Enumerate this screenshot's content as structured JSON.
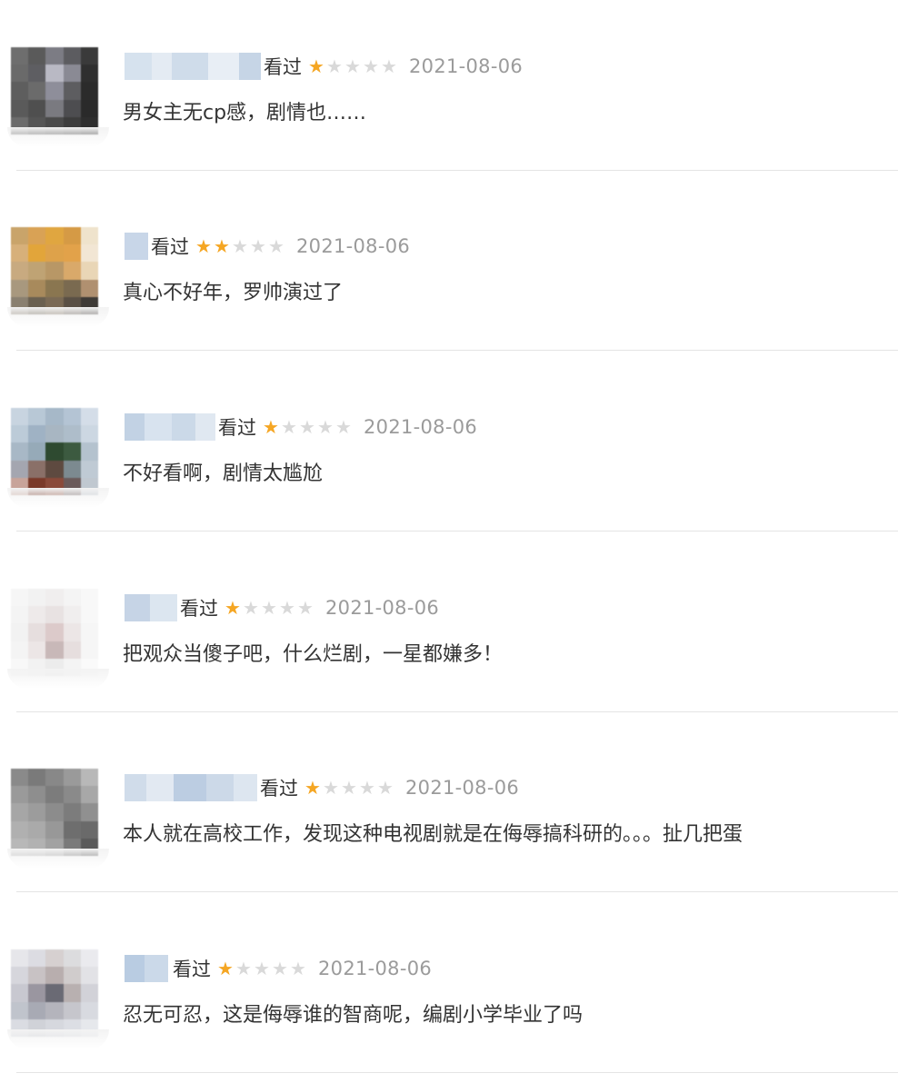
{
  "reviews": [
    {
      "status": "看过",
      "rating": 1,
      "max_rating": 5,
      "date": "2021-08-06",
      "comment": "男女主无cp感，剧情也……",
      "avatar_colors": [
        "#6e6e6e",
        "#5a5a5a",
        "#7c7c84",
        "#5c5c60",
        "#3a3a3a",
        "#6a6a6a",
        "#5e5e62",
        "#b9b9c4",
        "#8a8a94",
        "#2f2f2f",
        "#5e5e5e",
        "#6b6b6b",
        "#8e8e9a",
        "#5d5d60",
        "#2b2b2b",
        "#5a5a5a",
        "#4f4f4f",
        "#7a7a80",
        "#4d4d50",
        "#2a2a2a",
        "#6c6c6c",
        "#555555",
        "#4a4a4a",
        "#3c3c3c",
        "#2e2e2e"
      ]
    },
    {
      "status": "看过",
      "rating": 2,
      "max_rating": 5,
      "date": "2021-08-06",
      "comment": "真心不好年，罗帅演过了",
      "avatar_colors": [
        "#c9a46a",
        "#d9a255",
        "#e0a640",
        "#d59a45",
        "#efe3cc",
        "#d7b07a",
        "#e2a53a",
        "#dea24a",
        "#e2a24a",
        "#f2e6d4",
        "#c8aa80",
        "#bfa374",
        "#b89766",
        "#d9a96a",
        "#e9d6b6",
        "#a8987e",
        "#a88a5c",
        "#8a7650",
        "#7a6a50",
        "#b09070",
        "#8a8070",
        "#6a6050",
        "#7a6a55",
        "#5a5045",
        "#3e3a36"
      ]
    },
    {
      "status": "看过",
      "rating": 1,
      "max_rating": 5,
      "date": "2021-08-06",
      "comment": "不好看啊，剧情太尴尬",
      "avatar_colors": [
        "#c8d4e0",
        "#b8c8d6",
        "#a6b8c8",
        "#b4c4d4",
        "#d4dde8",
        "#bccbd8",
        "#9fb2c4",
        "#a8b6c2",
        "#aebdca",
        "#ccd7e2",
        "#a8b8c6",
        "#96aab8",
        "#2e4a30",
        "#3c5a40",
        "#b4c2ce",
        "#a4a6b0",
        "#8a7068",
        "#5e4a40",
        "#7c8a90",
        "#bfcad4",
        "#c8a49a",
        "#7a3a2a",
        "#8a4a3a",
        "#6a5a5a",
        "#c0c8d0"
      ]
    },
    {
      "status": "看过",
      "rating": 1,
      "max_rating": 5,
      "date": "2021-08-06",
      "comment": "把观众当傻子吧，什么烂剧，一星都嫌多！",
      "avatar_colors": [
        "#f6f6f6",
        "#f2f2f2",
        "#f0eeee",
        "#f4f4f4",
        "#f8f8f8",
        "#f4f4f4",
        "#eeeaea",
        "#e8e2e2",
        "#f0eeee",
        "#f8f8f8",
        "#f2f2f2",
        "#e6dede",
        "#dccaca",
        "#ece6e6",
        "#f6f6f6",
        "#f4f4f4",
        "#ece6e6",
        "#c8b8b8",
        "#e6dede",
        "#f6f6f6",
        "#f8f8f8",
        "#f2f2f2",
        "#ececec",
        "#f4f4f4",
        "#fafafa"
      ]
    },
    {
      "status": "看过",
      "rating": 1,
      "max_rating": 5,
      "date": "2021-08-06",
      "comment": "本人就在高校工作，发现这种电视剧就是在侮辱搞科研的。。。扯几把蛋",
      "avatar_colors": [
        "#8a8a8a",
        "#7a7a7a",
        "#888888",
        "#9a9a9a",
        "#b8b8b8",
        "#9a9a9a",
        "#8e8e8e",
        "#7c7c7c",
        "#8a8a8a",
        "#a8a8a8",
        "#a6a6a6",
        "#9c9c9c",
        "#8c8c8c",
        "#7c7c7c",
        "#909090",
        "#b0b0b0",
        "#aaaaaa",
        "#989898",
        "#6e6e6e",
        "#6a6a6a",
        "#b8b8b8",
        "#b2b2b2",
        "#a2a2a2",
        "#7a7a7a",
        "#5a5a5a"
      ]
    },
    {
      "status": "看过",
      "rating": 1,
      "max_rating": 5,
      "date": "2021-08-06",
      "comment": "忍无可忍，这是侮辱谁的智商呢，编剧小学毕业了吗",
      "avatar_colors": [
        "#e6e6ea",
        "#dcdce2",
        "#d6d0d0",
        "#dcdcde",
        "#eaeaee",
        "#d6d6dc",
        "#c8c2c4",
        "#b8aeae",
        "#d0cccc",
        "#e2e2e6",
        "#c8c8d0",
        "#9a96a0",
        "#6a6a74",
        "#b8b0b0",
        "#d2d2d8",
        "#c0c4cc",
        "#a8aab4",
        "#b4b4bc",
        "#c6c6cc",
        "#d8dae0",
        "#dadce2",
        "#d0d2d8",
        "#d6d8de",
        "#dcdee4",
        "#e6e8ec"
      ]
    }
  ]
}
